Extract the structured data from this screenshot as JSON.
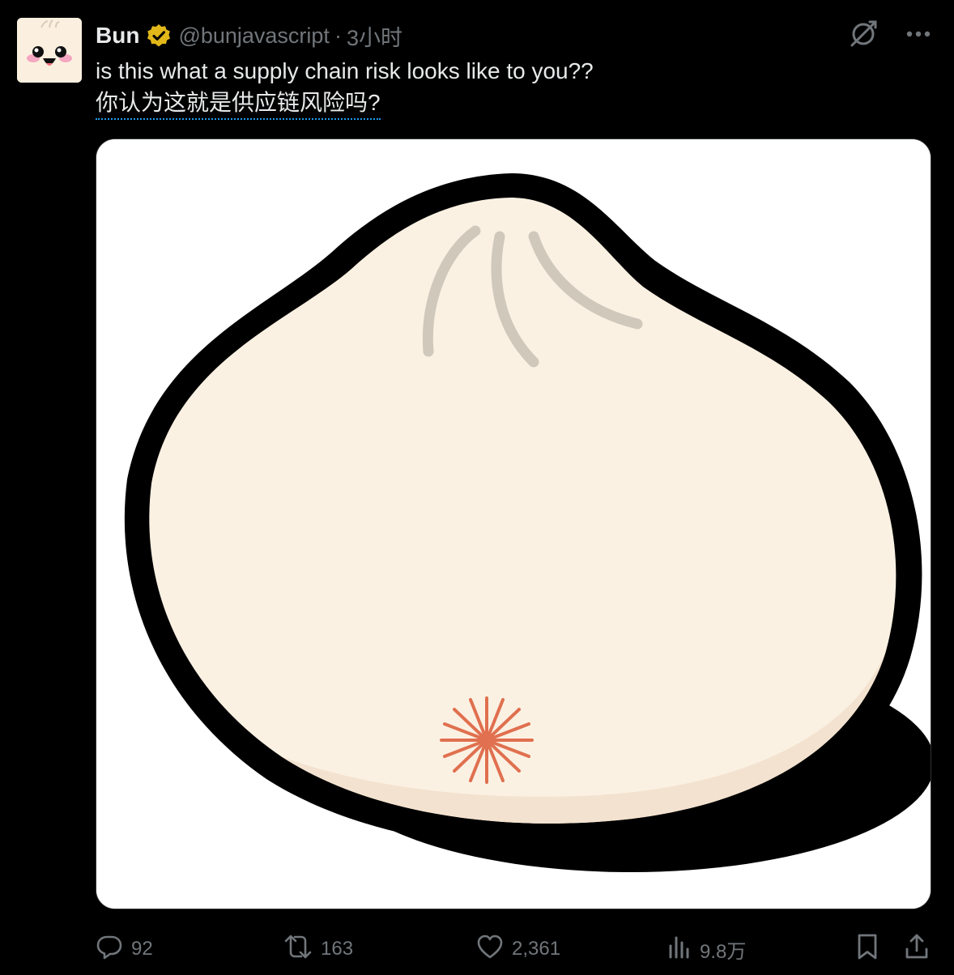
{
  "author": {
    "name": "Bun",
    "handle": "@bunjavascript",
    "separator": "·",
    "timestamp": "3小时",
    "avatar_icon": "bun-mascot-icon",
    "verified_icon": "verified-badge-icon",
    "verified_color": "#e2b719"
  },
  "post": {
    "text_en": "is this what a supply chain risk looks like to you??",
    "text_zh": "你认为这就是供应链风险吗?",
    "image_icon": "bun-dumpling-image"
  },
  "actions": {
    "replies": "92",
    "reposts": "163",
    "likes": "2,361",
    "views": "9.8万"
  },
  "icons": {
    "grok": "grok-icon",
    "more": "more-icon",
    "reply": "reply-icon",
    "repost": "repost-icon",
    "like": "like-icon",
    "views": "views-icon",
    "bookmark": "bookmark-icon",
    "share": "share-icon"
  },
  "colors": {
    "background": "#000000",
    "text_primary": "#e7e9ea",
    "text_secondary": "#71767b",
    "link_underline": "#1d9bf0"
  }
}
